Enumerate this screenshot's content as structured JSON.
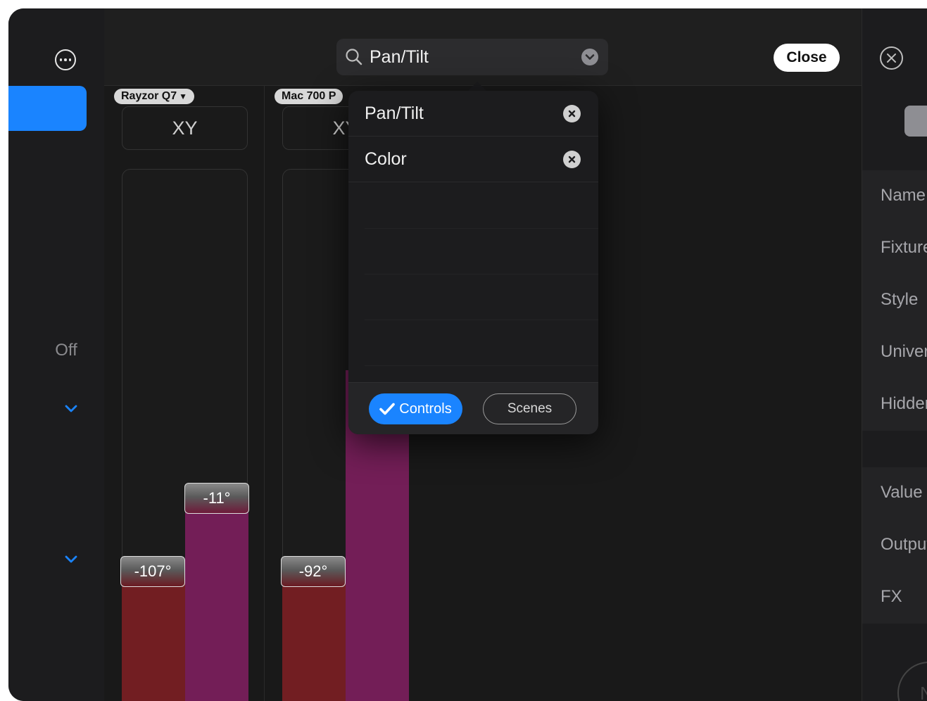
{
  "sidebar": {
    "more_icon": "ellipsis-circle-icon",
    "off_label": "Off",
    "chevron_icon": "chevron-down-icon",
    "accent_color": "#1a84ff"
  },
  "search": {
    "value": "Pan/Tilt",
    "icon": "search-icon",
    "dropdown_icon": "chevron-down-circle-icon"
  },
  "toolbar": {
    "close_label": "Close"
  },
  "fixtures": [
    {
      "name": "Rayzor Q7",
      "mode": "XY",
      "pan_label": "-107°",
      "tilt_label": "-11°"
    },
    {
      "name": "Mac 700 P",
      "mode": "XY",
      "pan_label": "-92°",
      "tilt_label": ""
    }
  ],
  "popover": {
    "items": [
      {
        "label": "Pan/Tilt",
        "remove_icon": "remove-circle-icon"
      },
      {
        "label": "Color",
        "remove_icon": "remove-circle-icon"
      }
    ],
    "controls_label": "Controls",
    "scenes_label": "Scenes",
    "controls_selected": true
  },
  "right_panel": {
    "close_icon": "close-circle-icon",
    "rows": [
      "Name",
      "Fixture",
      "Style",
      "Universe",
      "Hidden"
    ],
    "rows2": [
      "Value",
      "Output",
      "FX"
    ]
  },
  "colors": {
    "pan_bar": "#721e22",
    "tilt_bar": "#731e57",
    "background": "#191919"
  }
}
